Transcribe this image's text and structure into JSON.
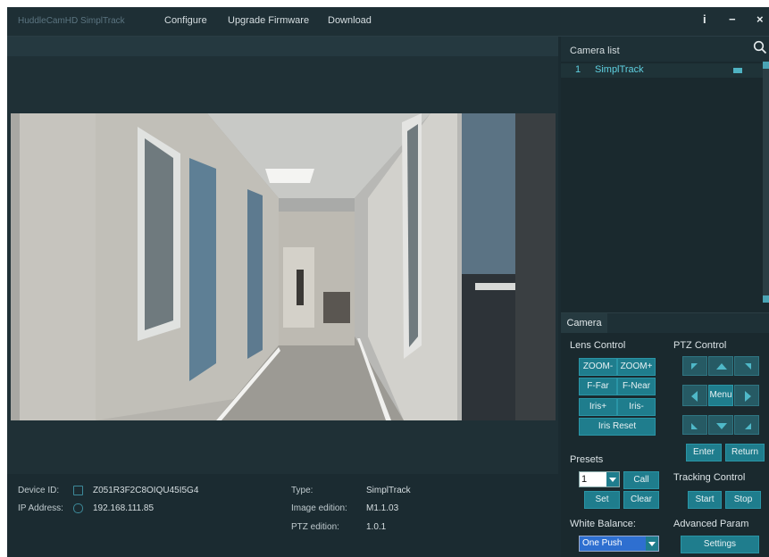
{
  "titlebar": {
    "app_title": "HuddleCamHD SimplTrack",
    "menu": [
      "Configure",
      "Upgrade Firmware",
      "Download"
    ],
    "info_label": "i",
    "minimize_label": "−",
    "close_label": "×"
  },
  "device": {
    "device_id_label": "Device ID:",
    "device_id": "Z051R3F2C8OIQU45I5G4",
    "ip_label": "IP Address:",
    "ip": "192.168.111.85",
    "type_label": "Type:",
    "type": "SimplTrack",
    "image_edition_label": "Image edition:",
    "image_edition": "M1.1.03",
    "ptz_edition_label": "PTZ edition:",
    "ptz_edition": "1.0.1"
  },
  "camera_list": {
    "title": "Camera list",
    "items": [
      {
        "index": "1",
        "name": "SimplTrack"
      }
    ]
  },
  "tabs": {
    "camera": "Camera"
  },
  "lens": {
    "title": "Lens Control",
    "zoom_minus": "ZOOM-",
    "zoom_plus": "ZOOM+",
    "f_far": "F-Far",
    "f_near": "F-Near",
    "iris_plus": "Iris+",
    "iris_minus": "Iris-",
    "iris_reset": "Iris Reset"
  },
  "ptz": {
    "title": "PTZ Control",
    "menu": "Menu",
    "enter": "Enter",
    "return": "Return"
  },
  "presets": {
    "title": "Presets",
    "selected": "1",
    "call": "Call",
    "set": "Set",
    "clear": "Clear"
  },
  "tracking": {
    "title": "Tracking Control",
    "start": "Start",
    "stop": "Stop"
  },
  "white_balance": {
    "title": "White Balance:",
    "selected": "One Push"
  },
  "advanced": {
    "title": "Advanced Param",
    "settings": "Settings"
  },
  "colors": {
    "background": "#1b2b31",
    "accent": "#1f7d8d",
    "accent_light": "#4aa3b4",
    "selection_blue": "#2e6fd0"
  }
}
